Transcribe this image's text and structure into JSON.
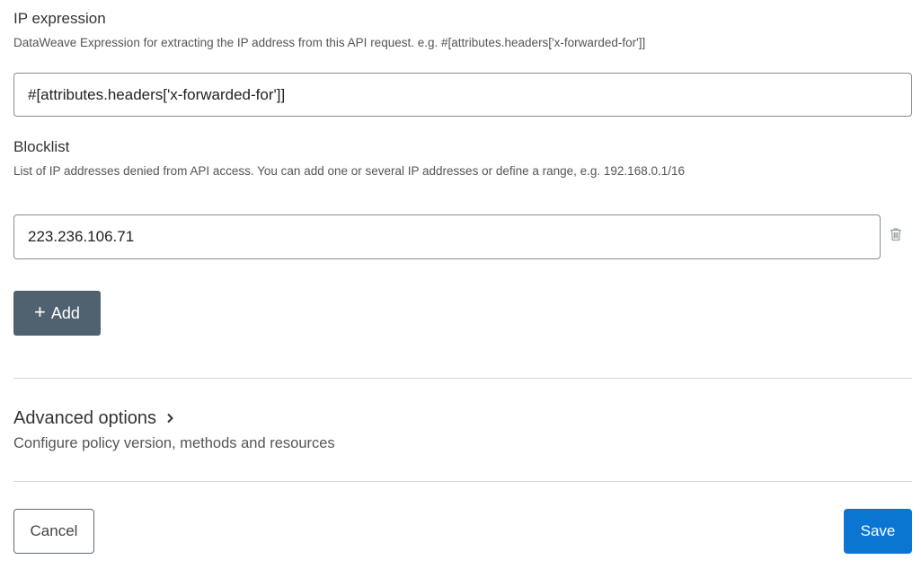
{
  "ip_expression": {
    "label": "IP expression",
    "help": "DataWeave Expression for extracting the IP address from this API request. e.g. #[attributes.headers['x-forwarded-for']]",
    "value": "#[attributes.headers['x-forwarded-for']]"
  },
  "blocklist": {
    "label": "Blocklist",
    "help": "List of IP addresses denied from API access. You can add one or several IP addresses or define a range, e.g. 192.168.0.1/16",
    "entries": [
      {
        "value": "223.236.106.71",
        "delete_icon": "trash-icon"
      }
    ],
    "add_icon": "plus-icon",
    "add_label": "Add"
  },
  "advanced": {
    "title": "Advanced options",
    "chevron_icon": "chevron-right-icon",
    "subtitle": "Configure policy version, methods and resources"
  },
  "footer": {
    "cancel_label": "Cancel",
    "save_label": "Save",
    "save_color": "#0b76d1",
    "add_color": "#506270"
  }
}
